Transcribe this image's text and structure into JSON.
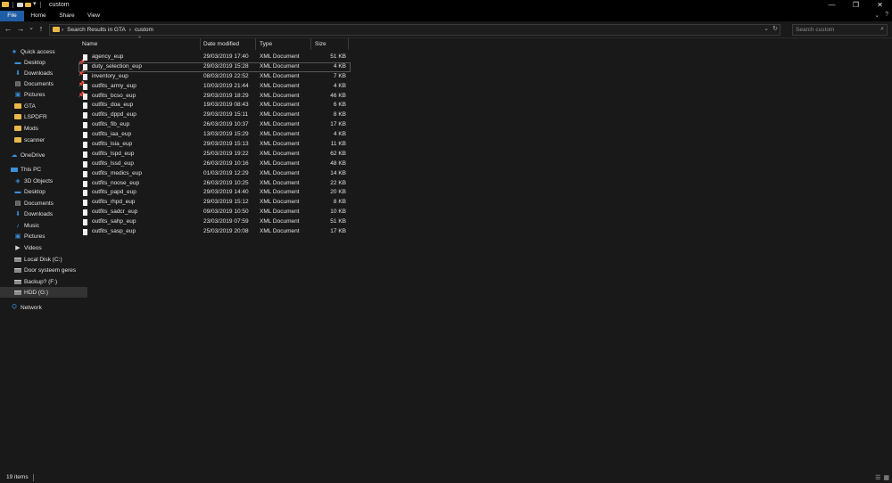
{
  "window": {
    "title": "custom"
  },
  "window_controls": {
    "minimize": "—",
    "maximize": "❐",
    "close": "✕"
  },
  "ribbon": {
    "tabs": [
      "File",
      "Home",
      "Share",
      "View"
    ],
    "collapse_glyph": "⌄",
    "help_glyph": "?"
  },
  "address": {
    "crumbs": [
      "Search Results in GTA",
      "›",
      "custom"
    ],
    "lead_chevron": "›",
    "dropdown_glyph": "⌄",
    "refresh_glyph": "↻"
  },
  "search": {
    "placeholder": "Search custom",
    "icon_glyph": "⌕"
  },
  "nav_buttons": {
    "back": "←",
    "forward": "→",
    "recent": "⌄",
    "up": "↑"
  },
  "columns": {
    "name": "Name",
    "date": "Date modified",
    "type": "Type",
    "size": "Size"
  },
  "sidebar": [
    {
      "label": "Quick access",
      "icon": "star-icon",
      "glyph": "★"
    },
    {
      "label": "Desktop",
      "icon": "desktop-icon",
      "glyph": "▬",
      "pin": "📌"
    },
    {
      "label": "Downloads",
      "icon": "download-icon",
      "glyph": "⬇",
      "pin": "📌"
    },
    {
      "label": "Documents",
      "icon": "documents-icon",
      "glyph": "▤",
      "pin": "📌"
    },
    {
      "label": "Pictures",
      "icon": "pictures-icon",
      "glyph": "▣",
      "pin": "📌"
    },
    {
      "label": "GTA",
      "icon": "folder-icon"
    },
    {
      "label": "LSPDFR",
      "icon": "folder-icon"
    },
    {
      "label": "Mods",
      "icon": "folder-icon"
    },
    {
      "label": "scanner",
      "icon": "folder-icon"
    },
    {
      "label": "OneDrive",
      "icon": "cloud-icon",
      "glyph": "☁"
    },
    {
      "label": "This PC",
      "icon": "computer-icon"
    },
    {
      "label": "3D Objects",
      "icon": "cube-icon",
      "glyph": "◈"
    },
    {
      "label": "Desktop",
      "icon": "desktop-icon",
      "glyph": "▬"
    },
    {
      "label": "Documents",
      "icon": "documents-icon",
      "glyph": "▤"
    },
    {
      "label": "Downloads",
      "icon": "download-icon",
      "glyph": "⬇"
    },
    {
      "label": "Music",
      "icon": "music-icon",
      "glyph": "♪"
    },
    {
      "label": "Pictures",
      "icon": "pictures-icon",
      "glyph": "▣"
    },
    {
      "label": "Videos",
      "icon": "video-icon",
      "glyph": "▶"
    },
    {
      "label": "Local Disk (C:)",
      "icon": "drive-icon"
    },
    {
      "label": "Door systeem geres",
      "icon": "drive-icon"
    },
    {
      "label": "Backup? (F:)",
      "icon": "drive-icon"
    },
    {
      "label": "HDD (G:)",
      "icon": "drive-icon",
      "selected": true
    },
    {
      "label": "Network",
      "icon": "network-icon",
      "glyph": "⛭"
    }
  ],
  "files": [
    {
      "name": "agency_eup",
      "date": "29/03/2019 17:40",
      "type": "XML Document",
      "size": "51 KB"
    },
    {
      "name": "duty_selection_eup",
      "date": "29/03/2019 15:28",
      "type": "XML Document",
      "size": "4 KB"
    },
    {
      "name": "inventory_eup",
      "date": "08/03/2019 22:52",
      "type": "XML Document",
      "size": "7 KB"
    },
    {
      "name": "outfits_army_eup",
      "date": "10/03/2019 21:44",
      "type": "XML Document",
      "size": "4 KB"
    },
    {
      "name": "outfits_bcso_eup",
      "date": "29/03/2019 18:29",
      "type": "XML Document",
      "size": "46 KB"
    },
    {
      "name": "outfits_doa_eup",
      "date": "19/03/2019 08:43",
      "type": "XML Document",
      "size": "6 KB"
    },
    {
      "name": "outfits_dppd_eup",
      "date": "29/03/2019 15:11",
      "type": "XML Document",
      "size": "8 KB"
    },
    {
      "name": "outfits_fib_eup",
      "date": "26/03/2019 10:37",
      "type": "XML Document",
      "size": "17 KB"
    },
    {
      "name": "outfits_iaa_eup",
      "date": "13/03/2019 15:29",
      "type": "XML Document",
      "size": "4 KB"
    },
    {
      "name": "outfits_lsia_eup",
      "date": "29/03/2019 15:13",
      "type": "XML Document",
      "size": "11 KB"
    },
    {
      "name": "outfits_lspd_eup",
      "date": "25/03/2019 19:22",
      "type": "XML Document",
      "size": "62 KB"
    },
    {
      "name": "outfits_lssd_eup",
      "date": "26/03/2019 10:16",
      "type": "XML Document",
      "size": "48 KB"
    },
    {
      "name": "outfits_medics_eup",
      "date": "01/03/2019 12:29",
      "type": "XML Document",
      "size": "14 KB"
    },
    {
      "name": "outfits_noose_eup",
      "date": "26/03/2019 10:25",
      "type": "XML Document",
      "size": "22 KB"
    },
    {
      "name": "outfits_papd_eup",
      "date": "29/03/2019 14:40",
      "type": "XML Document",
      "size": "20 KB"
    },
    {
      "name": "outfits_rhpd_eup",
      "date": "29/03/2019 15:12",
      "type": "XML Document",
      "size": "8 KB"
    },
    {
      "name": "outfits_sadcr_eup",
      "date": "09/03/2019 10:50",
      "type": "XML Document",
      "size": "10 KB"
    },
    {
      "name": "outfits_sahp_eup",
      "date": "23/03/2019 07:59",
      "type": "XML Document",
      "size": "51 KB"
    },
    {
      "name": "outfits_sasp_eup",
      "date": "25/03/2019 20:08",
      "type": "XML Document",
      "size": "17 KB"
    }
  ],
  "status": {
    "items": "19 items",
    "details_view_glyph": "☰",
    "tiles_view_glyph": "▦"
  },
  "colors": {
    "accent": "#1f5da5",
    "folder": "#e8b84a",
    "icon_blue": "#3a8fd8",
    "background": "#191919"
  }
}
